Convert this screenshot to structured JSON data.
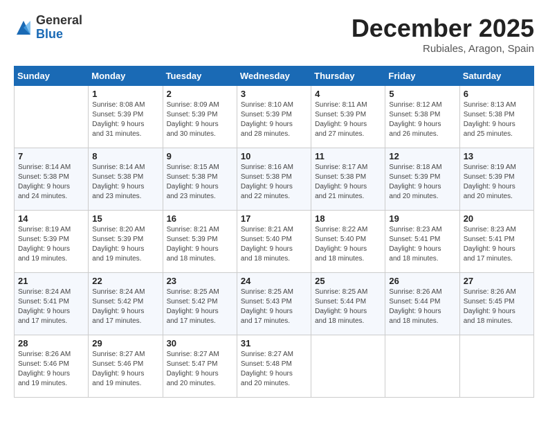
{
  "header": {
    "logo_general": "General",
    "logo_blue": "Blue",
    "month_title": "December 2025",
    "location": "Rubiales, Aragon, Spain"
  },
  "weekdays": [
    "Sunday",
    "Monday",
    "Tuesday",
    "Wednesday",
    "Thursday",
    "Friday",
    "Saturday"
  ],
  "weeks": [
    [
      {
        "num": "",
        "info": ""
      },
      {
        "num": "1",
        "info": "Sunrise: 8:08 AM\nSunset: 5:39 PM\nDaylight: 9 hours\nand 31 minutes."
      },
      {
        "num": "2",
        "info": "Sunrise: 8:09 AM\nSunset: 5:39 PM\nDaylight: 9 hours\nand 30 minutes."
      },
      {
        "num": "3",
        "info": "Sunrise: 8:10 AM\nSunset: 5:39 PM\nDaylight: 9 hours\nand 28 minutes."
      },
      {
        "num": "4",
        "info": "Sunrise: 8:11 AM\nSunset: 5:39 PM\nDaylight: 9 hours\nand 27 minutes."
      },
      {
        "num": "5",
        "info": "Sunrise: 8:12 AM\nSunset: 5:38 PM\nDaylight: 9 hours\nand 26 minutes."
      },
      {
        "num": "6",
        "info": "Sunrise: 8:13 AM\nSunset: 5:38 PM\nDaylight: 9 hours\nand 25 minutes."
      }
    ],
    [
      {
        "num": "7",
        "info": "Sunrise: 8:14 AM\nSunset: 5:38 PM\nDaylight: 9 hours\nand 24 minutes."
      },
      {
        "num": "8",
        "info": "Sunrise: 8:14 AM\nSunset: 5:38 PM\nDaylight: 9 hours\nand 23 minutes."
      },
      {
        "num": "9",
        "info": "Sunrise: 8:15 AM\nSunset: 5:38 PM\nDaylight: 9 hours\nand 23 minutes."
      },
      {
        "num": "10",
        "info": "Sunrise: 8:16 AM\nSunset: 5:38 PM\nDaylight: 9 hours\nand 22 minutes."
      },
      {
        "num": "11",
        "info": "Sunrise: 8:17 AM\nSunset: 5:38 PM\nDaylight: 9 hours\nand 21 minutes."
      },
      {
        "num": "12",
        "info": "Sunrise: 8:18 AM\nSunset: 5:39 PM\nDaylight: 9 hours\nand 20 minutes."
      },
      {
        "num": "13",
        "info": "Sunrise: 8:19 AM\nSunset: 5:39 PM\nDaylight: 9 hours\nand 20 minutes."
      }
    ],
    [
      {
        "num": "14",
        "info": "Sunrise: 8:19 AM\nSunset: 5:39 PM\nDaylight: 9 hours\nand 19 minutes."
      },
      {
        "num": "15",
        "info": "Sunrise: 8:20 AM\nSunset: 5:39 PM\nDaylight: 9 hours\nand 19 minutes."
      },
      {
        "num": "16",
        "info": "Sunrise: 8:21 AM\nSunset: 5:39 PM\nDaylight: 9 hours\nand 18 minutes."
      },
      {
        "num": "17",
        "info": "Sunrise: 8:21 AM\nSunset: 5:40 PM\nDaylight: 9 hours\nand 18 minutes."
      },
      {
        "num": "18",
        "info": "Sunrise: 8:22 AM\nSunset: 5:40 PM\nDaylight: 9 hours\nand 18 minutes."
      },
      {
        "num": "19",
        "info": "Sunrise: 8:23 AM\nSunset: 5:41 PM\nDaylight: 9 hours\nand 18 minutes."
      },
      {
        "num": "20",
        "info": "Sunrise: 8:23 AM\nSunset: 5:41 PM\nDaylight: 9 hours\nand 17 minutes."
      }
    ],
    [
      {
        "num": "21",
        "info": "Sunrise: 8:24 AM\nSunset: 5:41 PM\nDaylight: 9 hours\nand 17 minutes."
      },
      {
        "num": "22",
        "info": "Sunrise: 8:24 AM\nSunset: 5:42 PM\nDaylight: 9 hours\nand 17 minutes."
      },
      {
        "num": "23",
        "info": "Sunrise: 8:25 AM\nSunset: 5:42 PM\nDaylight: 9 hours\nand 17 minutes."
      },
      {
        "num": "24",
        "info": "Sunrise: 8:25 AM\nSunset: 5:43 PM\nDaylight: 9 hours\nand 17 minutes."
      },
      {
        "num": "25",
        "info": "Sunrise: 8:25 AM\nSunset: 5:44 PM\nDaylight: 9 hours\nand 18 minutes."
      },
      {
        "num": "26",
        "info": "Sunrise: 8:26 AM\nSunset: 5:44 PM\nDaylight: 9 hours\nand 18 minutes."
      },
      {
        "num": "27",
        "info": "Sunrise: 8:26 AM\nSunset: 5:45 PM\nDaylight: 9 hours\nand 18 minutes."
      }
    ],
    [
      {
        "num": "28",
        "info": "Sunrise: 8:26 AM\nSunset: 5:46 PM\nDaylight: 9 hours\nand 19 minutes."
      },
      {
        "num": "29",
        "info": "Sunrise: 8:27 AM\nSunset: 5:46 PM\nDaylight: 9 hours\nand 19 minutes."
      },
      {
        "num": "30",
        "info": "Sunrise: 8:27 AM\nSunset: 5:47 PM\nDaylight: 9 hours\nand 20 minutes."
      },
      {
        "num": "31",
        "info": "Sunrise: 8:27 AM\nSunset: 5:48 PM\nDaylight: 9 hours\nand 20 minutes."
      },
      {
        "num": "",
        "info": ""
      },
      {
        "num": "",
        "info": ""
      },
      {
        "num": "",
        "info": ""
      }
    ]
  ]
}
